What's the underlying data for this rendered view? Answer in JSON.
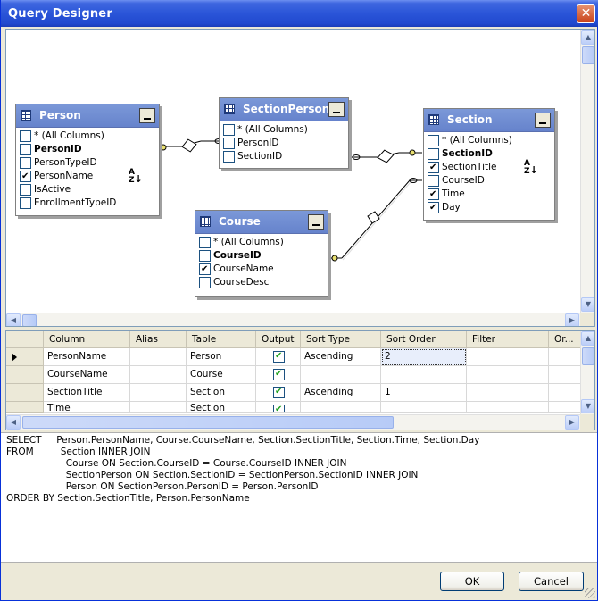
{
  "window": {
    "title": "Query Designer",
    "close_glyph": "✕"
  },
  "diagram": {
    "tables": {
      "person": {
        "name": "Person",
        "columns": [
          {
            "label": "* (All Columns)",
            "checked": false,
            "key": false
          },
          {
            "label": "PersonID",
            "checked": false,
            "key": true
          },
          {
            "label": "PersonTypeID",
            "checked": false,
            "key": false
          },
          {
            "label": "PersonName",
            "checked": true,
            "key": false
          },
          {
            "label": "IsActive",
            "checked": false,
            "key": false
          },
          {
            "label": "EnrollmentTypeID",
            "checked": false,
            "key": false
          }
        ]
      },
      "sectionperson": {
        "name": "SectionPerson",
        "columns": [
          {
            "label": "* (All Columns)",
            "checked": false,
            "key": false
          },
          {
            "label": "PersonID",
            "checked": false,
            "key": false
          },
          {
            "label": "SectionID",
            "checked": false,
            "key": false
          }
        ]
      },
      "section": {
        "name": "Section",
        "columns": [
          {
            "label": "* (All Columns)",
            "checked": false,
            "key": false
          },
          {
            "label": "SectionID",
            "checked": false,
            "key": true
          },
          {
            "label": "SectionTitle",
            "checked": true,
            "key": false
          },
          {
            "label": "CourseID",
            "checked": false,
            "key": false
          },
          {
            "label": "Time",
            "checked": true,
            "key": false
          },
          {
            "label": "Day",
            "checked": true,
            "key": false
          }
        ]
      },
      "course": {
        "name": "Course",
        "columns": [
          {
            "label": "* (All Columns)",
            "checked": false,
            "key": false
          },
          {
            "label": "CourseID",
            "checked": false,
            "key": true
          },
          {
            "label": "CourseName",
            "checked": true,
            "key": false
          },
          {
            "label": "CourseDesc",
            "checked": false,
            "key": false
          }
        ]
      }
    },
    "sort_icon_text": "A\nZ↓"
  },
  "grid": {
    "headers": [
      "",
      "Column",
      "Alias",
      "Table",
      "Output",
      "Sort Type",
      "Sort Order",
      "Filter",
      "Or..."
    ],
    "rows": [
      {
        "column": "PersonName",
        "alias": "",
        "table": "Person",
        "output": true,
        "sort_type": "Ascending",
        "sort_order": "2",
        "filter": ""
      },
      {
        "column": "CourseName",
        "alias": "",
        "table": "Course",
        "output": true,
        "sort_type": "",
        "sort_order": "",
        "filter": ""
      },
      {
        "column": "SectionTitle",
        "alias": "",
        "table": "Section",
        "output": true,
        "sort_type": "Ascending",
        "sort_order": "1",
        "filter": ""
      },
      {
        "column": "Time",
        "alias": "",
        "table": "Section",
        "output": true,
        "sort_type": "",
        "sort_order": "",
        "filter": ""
      }
    ]
  },
  "sql": {
    "lines": [
      "SELECT     Person.PersonName, Course.CourseName, Section.SectionTitle, Section.Time, Section.Day",
      "FROM         Section INNER JOIN",
      "                    Course ON Section.CourseID = Course.CourseID INNER JOIN",
      "                    SectionPerson ON Section.SectionID = SectionPerson.SectionID INNER JOIN",
      "                    Person ON SectionPerson.PersonID = Person.PersonID",
      "ORDER BY Section.SectionTitle, Person.PersonName"
    ]
  },
  "buttons": {
    "ok": "OK",
    "cancel": "Cancel"
  }
}
